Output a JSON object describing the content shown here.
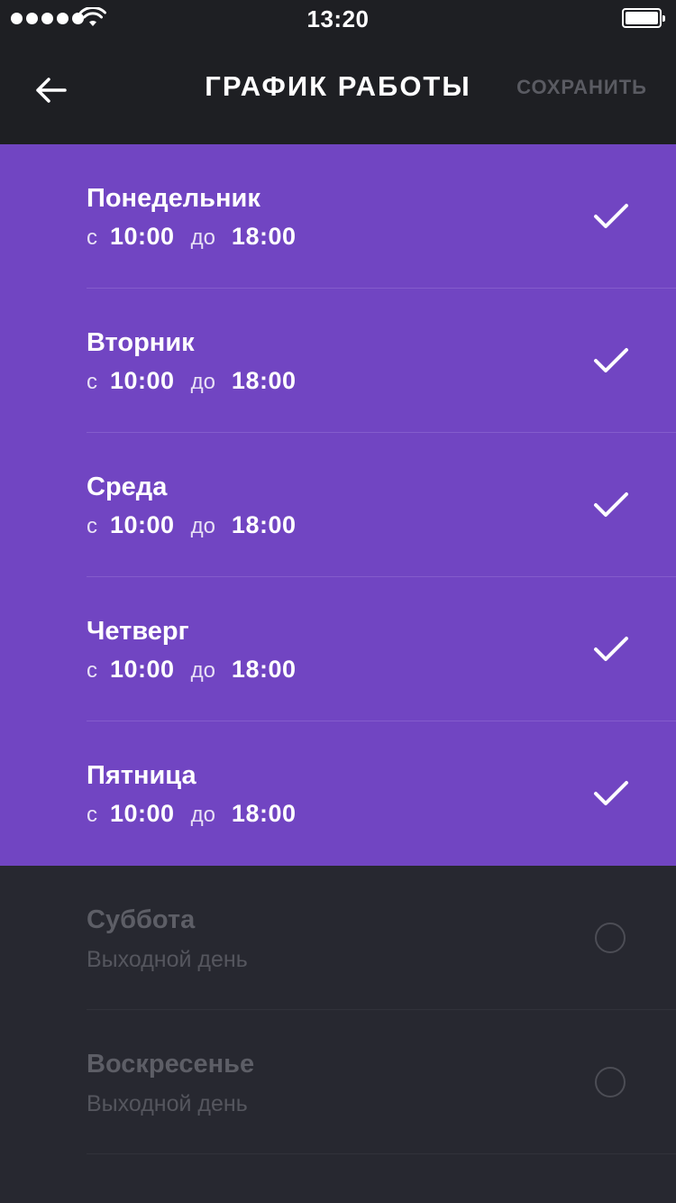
{
  "status_bar": {
    "time": "13:20",
    "signal_icon": "signal-dots-icon",
    "wifi_icon": "wifi-icon",
    "battery_icon": "battery-icon"
  },
  "nav": {
    "back_icon": "arrow-left-icon",
    "title": "ГРАФИК РАБОТЫ",
    "save_label": "СОХРАНИТЬ"
  },
  "colors": {
    "active_bg": "#7145c2",
    "dark_bg": "#272830",
    "header_bg": "#1e1f23",
    "disabled_text": "#5d5e66"
  },
  "labels": {
    "from": "с",
    "to": "до"
  },
  "days": [
    {
      "name": "Понедельник",
      "active": true,
      "from": "10:00",
      "to": "18:00"
    },
    {
      "name": "Вторник",
      "active": true,
      "from": "10:00",
      "to": "18:00"
    },
    {
      "name": "Среда",
      "active": true,
      "from": "10:00",
      "to": "18:00"
    },
    {
      "name": "Четверг",
      "active": true,
      "from": "10:00",
      "to": "18:00"
    },
    {
      "name": "Пятница",
      "active": true,
      "from": "10:00",
      "to": "18:00"
    },
    {
      "name": "Суббота",
      "active": false,
      "status": "Выходной день"
    },
    {
      "name": "Воскресенье",
      "active": false,
      "status": "Выходной день"
    }
  ]
}
